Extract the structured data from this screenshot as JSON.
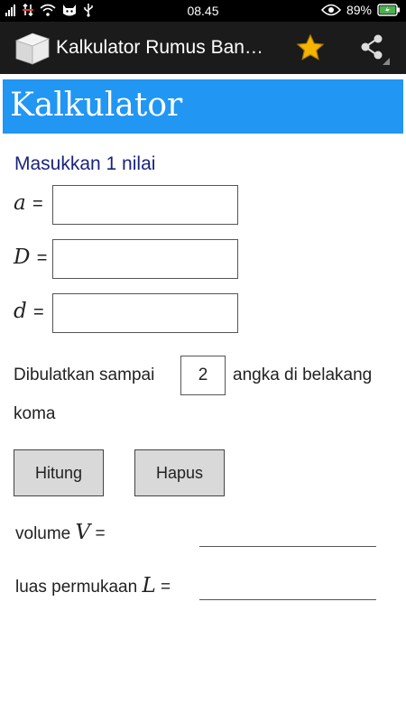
{
  "status_bar": {
    "time": "08.45",
    "battery": "89%"
  },
  "action_bar": {
    "title": "Kalkulator Rumus Ban…"
  },
  "header": {
    "title": "Kalkulator"
  },
  "form": {
    "prompt": "Masukkan 1 nilai",
    "fields": [
      {
        "var": "a",
        "eq": "=",
        "value": ""
      },
      {
        "var": "D",
        "eq": "=",
        "value": ""
      },
      {
        "var": "d",
        "eq": "=",
        "value": ""
      }
    ],
    "round_prefix": "Dibulatkan sampai",
    "round_value": "2",
    "round_suffix": "angka di belakang",
    "round_suffix2": "koma"
  },
  "buttons": {
    "hitung": "Hitung",
    "hapus": "Hapus"
  },
  "results": {
    "volume_text": "volume",
    "volume_var": "V",
    "luas_text": "luas permukaan",
    "luas_var": "L",
    "eq": "="
  },
  "colors": {
    "header_bg": "#2196f3",
    "prompt_text": "#1a237e",
    "action_bar": "#1b1b1b",
    "star": "#f5b400"
  }
}
